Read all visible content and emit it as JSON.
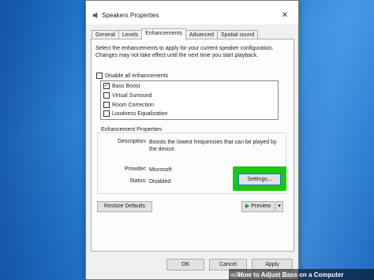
{
  "window": {
    "title": "Speakers Properties",
    "close_glyph": "✕",
    "app_icon": "speaker-icon"
  },
  "tabs": [
    {
      "label": "General",
      "active": false
    },
    {
      "label": "Levels",
      "active": false
    },
    {
      "label": "Enhancements",
      "active": true
    },
    {
      "label": "Advanced",
      "active": false
    },
    {
      "label": "Spatial sound",
      "active": false
    }
  ],
  "enhancements": {
    "intro": "Select the enhancements to apply for your current speaker configuration. Changes may not take effect until the next time you start playback.",
    "disable_all": {
      "label": "Disable all enhancements",
      "checked": false
    },
    "items": [
      {
        "label": "Bass Boost",
        "checked": true
      },
      {
        "label": "Virtual Surround",
        "checked": false
      },
      {
        "label": "Room Correction",
        "checked": false
      },
      {
        "label": "Loudness Equalization",
        "checked": false
      }
    ]
  },
  "properties": {
    "group_label": "Enhancement Properties",
    "description_label": "Description:",
    "description_value": "Boosts the lowest frequencies that can be played by the device.",
    "provider_label": "Provider:",
    "provider_value": "Microsoft",
    "status_label": "Status:",
    "status_value": "Disabled",
    "settings_button": "Settings..."
  },
  "buttons": {
    "restore_defaults": "Restore Defaults",
    "preview": "Preview",
    "preview_dropdown": "▾",
    "ok": "OK",
    "cancel": "Cancel",
    "apply": "Apply"
  },
  "caption": {
    "brand": "wiki",
    "text": "How to Adjust Bass on a Computer"
  },
  "colors": {
    "highlight": "#22c414",
    "desktop": "#2477cc"
  }
}
